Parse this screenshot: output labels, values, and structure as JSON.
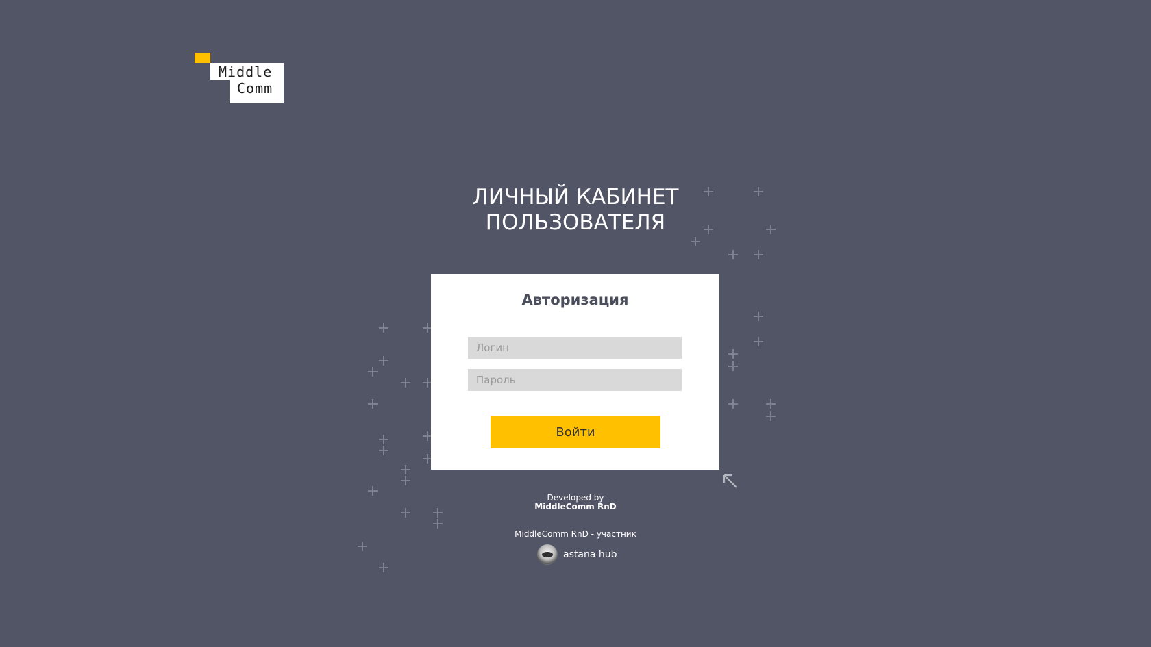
{
  "logo": {
    "line1": "Middle",
    "line2": "Comm"
  },
  "title": {
    "line1": "ЛИЧНЫЙ КАБИНЕТ",
    "line2": "ПОЛЬЗОВАТЕЛЯ"
  },
  "auth": {
    "heading": "Авторизация",
    "login_placeholder": "Логин",
    "password_placeholder": "Пароль",
    "submit_label": "Войти"
  },
  "footer": {
    "developed_by": "Developed by",
    "developer_name": "MiddleComm RnD",
    "member_text": "MiddleComm RnD - участник",
    "hub_name": "astana hub"
  },
  "colors": {
    "background": "#525566",
    "accent": "#ffc000",
    "card": "#ffffff",
    "field": "#d9d9d9"
  },
  "icons": {
    "arrow": "arrow-up-left-icon",
    "hub": "astana-hub-logo-icon",
    "decoration": "plus-icon"
  }
}
